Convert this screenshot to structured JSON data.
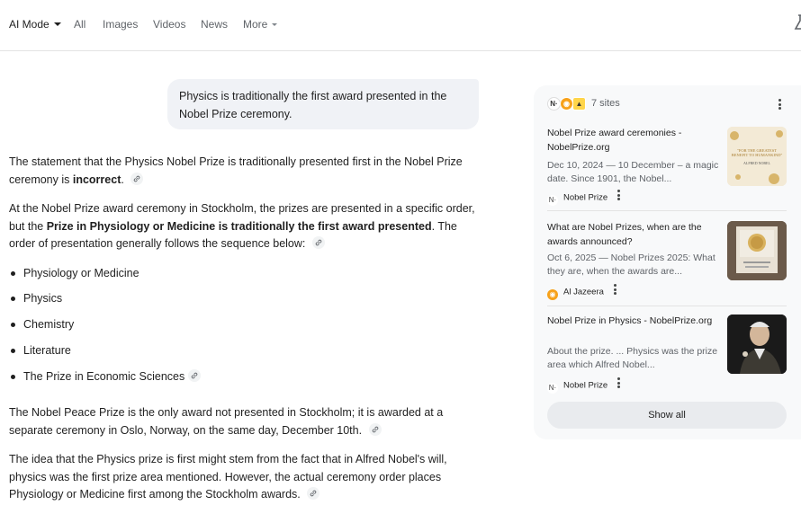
{
  "nav": {
    "tabs": [
      {
        "label": "AI Mode"
      },
      {
        "label": "All"
      },
      {
        "label": "Images"
      },
      {
        "label": "Videos"
      },
      {
        "label": "News"
      },
      {
        "label": "More"
      }
    ]
  },
  "query": {
    "text": "Physics is traditionally the first award presented in the Nobel Prize ceremony."
  },
  "answer": {
    "p1_a": "The statement that the Physics Nobel Prize is traditionally presented first in the Nobel Prize ceremony is ",
    "p1_b": "incorrect",
    "p1_c": ".",
    "p2_a": "At the Nobel Prize award ceremony in Stockholm, the prizes are presented in a specific order, but the ",
    "p2_b": "Prize in Physiology or Medicine is traditionally the first award presented",
    "p2_c": ". The order of presentation generally follows the sequence below:",
    "list": [
      "Physiology or Medicine",
      "Physics",
      "Chemistry",
      "Literature",
      "The Prize in Economic Sciences"
    ],
    "p3": "The Nobel Peace Prize is the only award not presented in Stockholm; it is awarded at a separate ceremony in Oslo, Norway, on the same day, December 10th.",
    "p4": "The idea that the Physics prize is first might stem from the fact that in Alfred Nobel's will, physics was the first prize area mentioned. However, the actual ceremony order places Physiology or Medicine first among the Stockholm awards."
  },
  "sources": {
    "count_label": "7 sites",
    "items": [
      {
        "title": "Nobel Prize award ceremonies - NobelPrize.org",
        "snippet": "Dec 10, 2024 — 10 December – a magic date. Since 1901, the Nobel...",
        "site": "Nobel Prize",
        "thumb_text": "\"FOR THE GREATEST BENEFIT TO HUMANKIND\" ALFRED NOBEL"
      },
      {
        "title": "What are Nobel Prizes, when are the awards announced?",
        "snippet": "Oct 6, 2025 — Nobel Prizes 2025: What they are, when the awards are...",
        "site": "Al Jazeera",
        "thumb_text": ""
      },
      {
        "title": "Nobel Prize in Physics - NobelPrize.org",
        "snippet": "About the prize. ... Physics was the prize area which Alfred Nobel...",
        "site": "Nobel Prize",
        "thumb_text": ""
      }
    ],
    "show_all_label": "Show all"
  },
  "colors": {
    "accent_text": "#1f1f1f",
    "muted_text": "#5f6368",
    "bubble_bg": "#f0f2f6",
    "panel_bg": "#f8f9fa",
    "aljazeera_orange": "#f7a11a"
  },
  "icons": [
    "chevron-down-icon",
    "link-icon",
    "more-vert-icon",
    "labs-icon",
    "nobel-favicon",
    "aljazeera-favicon"
  ]
}
